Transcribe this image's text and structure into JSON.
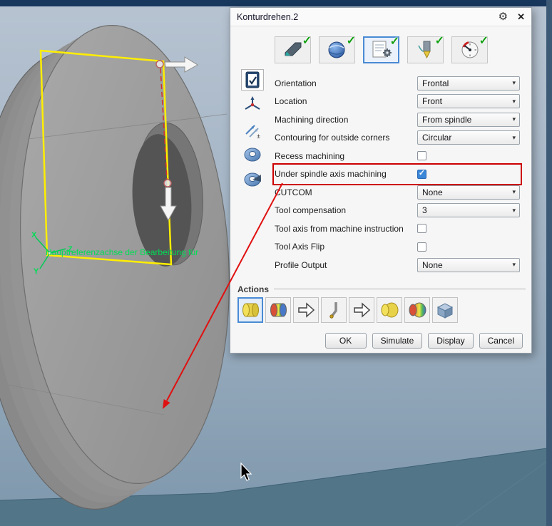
{
  "window": {
    "title": "Konturdrehen.2"
  },
  "icons": {
    "check": "✓",
    "gear": "⚙",
    "close": "✕",
    "chevron": "▾"
  },
  "tabs": {
    "items": [
      {
        "name": "strategy"
      },
      {
        "name": "geometry"
      },
      {
        "name": "machining-parameters",
        "selected": true
      },
      {
        "name": "tool"
      },
      {
        "name": "feeds-speeds"
      }
    ]
  },
  "fields": [
    {
      "label": "Orientation",
      "type": "select",
      "value": "Frontal"
    },
    {
      "label": "Location",
      "type": "select",
      "value": "Front"
    },
    {
      "label": "Machining direction",
      "type": "select",
      "value": "From spindle"
    },
    {
      "label": "Contouring for outside corners",
      "type": "select",
      "value": "Circular"
    },
    {
      "label": "Recess machining",
      "type": "checkbox",
      "checked": false
    },
    {
      "label": "Under spindle axis machining",
      "type": "checkbox",
      "checked": true,
      "highlighted": true
    },
    {
      "label": "CUTCOM",
      "type": "select",
      "value": "None"
    },
    {
      "label": "Tool compensation",
      "type": "select",
      "value": "3"
    },
    {
      "label": "Tool axis from machine instruction",
      "type": "checkbox",
      "checked": false
    },
    {
      "label": "Tool Axis Flip",
      "type": "checkbox",
      "checked": false
    },
    {
      "label": "Profile Output",
      "type": "select",
      "value": "None"
    }
  ],
  "actions": {
    "label": "Actions"
  },
  "buttons": {
    "ok": "OK",
    "simulate": "Simulate",
    "display": "Display",
    "cancel": "Cancel"
  },
  "viewport": {
    "annotation": "Hauptreferenzachse der Bearbeitung für",
    "axes": {
      "x": "X",
      "y": "Y",
      "z": "Z"
    }
  },
  "colors": {
    "highlight_red": "#cc0000",
    "check_green": "#14a014",
    "selection_blue": "#4a8ad4",
    "profile_yellow": "#ffee00",
    "annotation_green": "#00dd55"
  }
}
